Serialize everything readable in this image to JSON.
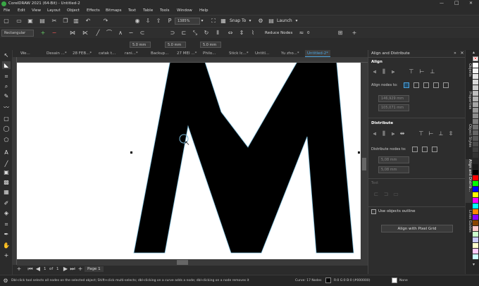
{
  "titlebar": {
    "title": "CorelDRAW 2021 (64-Bit) - Untitled-2",
    "min": "—",
    "max": "□",
    "close": "✕"
  },
  "menu": [
    "File",
    "Edit",
    "View",
    "Layout",
    "Object",
    "Effects",
    "Bitmaps",
    "Text",
    "Table",
    "Tools",
    "Window",
    "Help"
  ],
  "toolbar": {
    "zoom": "1385%",
    "snap": "Snap To",
    "launch": "Launch"
  },
  "propbar": {
    "shape": "Rectangular",
    "reduce_nodes": "Reduce Nodes",
    "reduce_value": "0"
  },
  "doc_tabs": [
    "We...",
    "Desain ...*",
    "28 FEB...*",
    "catak t...",
    "rani...*",
    "Backup...",
    "27 MEI ...*",
    "Philo...",
    "Stick lc...*",
    "Untitl...",
    "Yu zho...*",
    "Untitled-2*"
  ],
  "active_tab_index": 11,
  "status": {
    "hint": "Dbl-click tool selects all nodes on the selected object; Shift+click multi-selects; dbl-clicking on a curve adds a node; dbl-clicking on a node removes it",
    "curve": "Curve: 17 Nodes",
    "fill": "R:0 G:0 B:0 (#000000)",
    "outline": "None"
  },
  "page_nav": {
    "current": "1",
    "of": "of",
    "total": "1",
    "page_tab": "Page 1"
  },
  "docker": {
    "title": "Align and Distribute",
    "align_label": "Align",
    "align_nodes_label": "Align nodes to:",
    "align_x": "146,929 mm",
    "align_y": "105,071 mm",
    "distribute_label": "Distribute",
    "distribute_nodes_label": "Distribute nodes to:",
    "dist_x": "5,08 mm",
    "dist_y": "5,08 mm",
    "text_label": "Text",
    "use_outline": "Use objects outline",
    "align_grid_button": "Align with Pixel Grid"
  },
  "side_tabs": [
    "Objects",
    "Properties",
    "Object Styles",
    "Align and Distrib...",
    "Lines Guides"
  ],
  "nudge": {
    "x": "5.0 mm",
    "y": "5.0 mm",
    "w": "5.0 mm",
    "h": "5.0 mm"
  },
  "palette": [
    "#ffffff",
    "#f2f2f2",
    "#e6e6e6",
    "#d9d9d9",
    "#cccccc",
    "#bfbfbf",
    "#b3b3b3",
    "#a6a6a6",
    "#999999",
    "#8c8c8c",
    "#808080",
    "#737373",
    "#666666",
    "#595959",
    "#4d4d4d",
    "#404040",
    "#333333",
    "#262626",
    "#1a1a1a",
    "#000000",
    "#ff0000",
    "#00ff00",
    "#0000ff",
    "#ffff00",
    "#ff00ff",
    "#00ffff",
    "#ff8800",
    "#8800ff",
    "#884400",
    "#ffcccc",
    "#ccffcc",
    "#ccccff",
    "#ffffcc",
    "#ffccff",
    "#ccffff"
  ]
}
